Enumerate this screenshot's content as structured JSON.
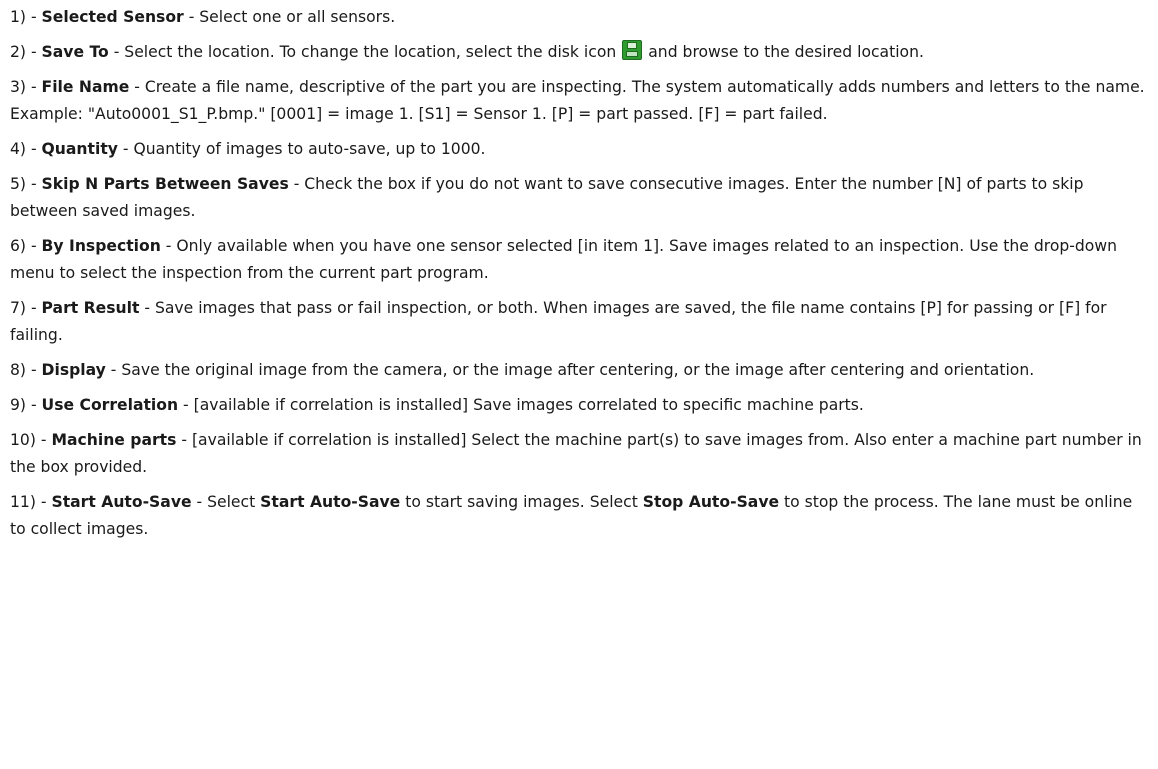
{
  "items": [
    {
      "num": "1) - ",
      "title": "Selected Sensor",
      "text": " - Select one or all sensors."
    },
    {
      "num": "2) - ",
      "title": "Save To",
      "text_before_icon": " - Select the location. To change the location, select the disk icon",
      "icon": "disk-icon",
      "text_after_icon": "and browse to the desired location."
    },
    {
      "num": "3) - ",
      "title": "File Name",
      "text": " - Create a file name, descriptive of the part you are inspecting. The system automatically adds numbers and letters to the name. Example:    \"Auto0001_S1_P.bmp.\" [0001] = image 1. [S1] = Sensor 1. [P] = part passed. [F] = part failed."
    },
    {
      "num": "4) - ",
      "title": "Quantity",
      "text": " - Quantity of images to auto-save, up to 1000."
    },
    {
      "num": "5) - ",
      "title": "Skip N Parts Between Saves",
      "text": " - Check the box if you do not want to save consecutive images. Enter the number [N] of parts to skip between saved images."
    },
    {
      "num": "6) - ",
      "title": "By Inspection",
      "text": " - Only available when you have one sensor selected [in item 1]. Save images related to an inspection. Use the drop-down menu to select the inspection from the current part program."
    },
    {
      "num": "7) - ",
      "title": "Part Result",
      "text": " - Save images that pass or fail inspection, or both. When images are saved, the file name contains [P] for passing or [F] for failing."
    },
    {
      "num": "8) - ",
      "title": "Display",
      "text": " - Save the original image from the camera, or the image after centering, or the image after centering and orientation."
    },
    {
      "num": "9) - ",
      "title": "Use Correlation",
      "text": " - [available if correlation is installed] Save images correlated to specific machine parts."
    },
    {
      "num": "10) - ",
      "title": "Machine parts",
      "text": " - [available if correlation is installed] Select the machine part(s) to save images from. Also enter a machine part number in the box provided."
    },
    {
      "num": "11) - ",
      "title": "Start Auto-Save",
      "text_a": " - Select ",
      "bold_b": "Start Auto-Save",
      "text_c": " to start saving images. Select ",
      "bold_d": "Stop Auto-Save",
      "text_e": " to stop the process. The lane must be online to collect images."
    }
  ]
}
